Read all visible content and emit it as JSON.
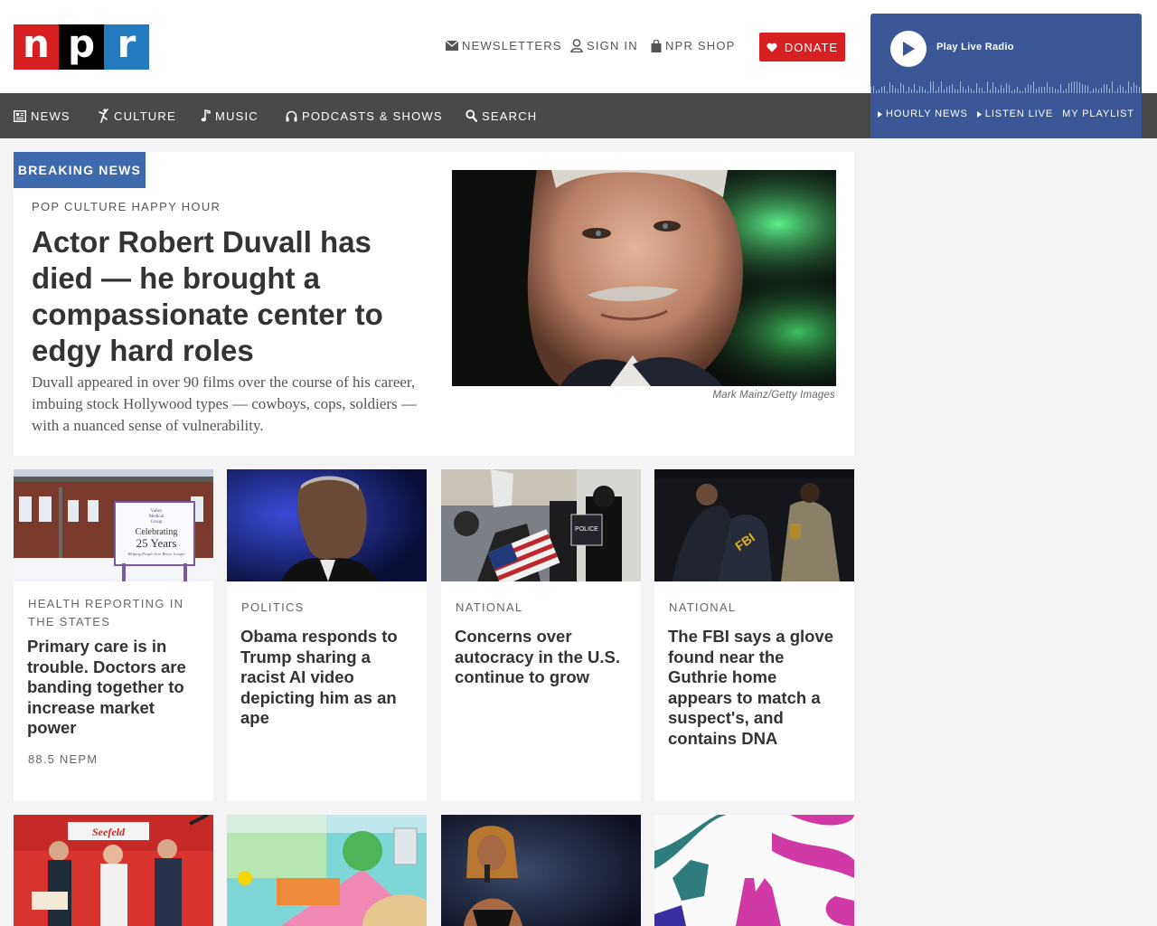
{
  "brand": {
    "logo_letters": [
      "n",
      "p",
      "r"
    ],
    "colors": {
      "red": "#d62021",
      "blue": "#237bbd",
      "black": "#000000",
      "nav_bg": "#494949",
      "player_bg": "#3a5898",
      "breaking_bg": "#3d69ad"
    }
  },
  "utility_nav": {
    "newsletters": {
      "label": "Newsletters",
      "icon": "envelope-icon"
    },
    "sign_in": {
      "label": "Sign In",
      "icon": "user-icon"
    },
    "shop": {
      "label": "NPR Shop",
      "icon": "shopping-bag-icon"
    },
    "donate": {
      "label": "Donate",
      "icon": "heart-icon"
    }
  },
  "main_nav": [
    {
      "label": "News",
      "icon": "newspaper-icon"
    },
    {
      "label": "Culture",
      "icon": "dancer-icon"
    },
    {
      "label": "Music",
      "icon": "music-note-icon"
    },
    {
      "label": "Podcasts & Shows",
      "icon": "headphones-icon"
    },
    {
      "label": "Search",
      "icon": "search-icon"
    }
  ],
  "player": {
    "play_label": "Play Live Radio",
    "links": [
      "Hourly News",
      "Listen Live",
      "My Playlist"
    ]
  },
  "hero": {
    "badge": "BREAKING NEWS",
    "slug": "POP CULTURE HAPPY HOUR",
    "title": "Actor Robert Duvall has died — he brought a compassionate center to edgy hard roles",
    "teaser": "Duvall appeared in over 90 films over the course of his career, imbuing stock Hollywood types — cowboys, cops, soldiers — with a nuanced sense of vulnerability.",
    "image_credit": "Mark Mainz/Getty Images"
  },
  "stories": [
    {
      "slug": "Health Reporting in the States",
      "title": "Primary care is in trouble. Doctors are banding together to increase market power",
      "meta": "88.5 NEPM",
      "sign_lines": [
        "Valley",
        "Medical",
        "Group",
        "Celebrating",
        "25 Years",
        "Helping People Live Better Longer"
      ]
    },
    {
      "slug": "Politics",
      "title": "Obama responds to Trump sharing a racist AI video depicting him as an ape",
      "meta": ""
    },
    {
      "slug": "National",
      "title": "Concerns over autocracy in the U.S. continue to grow",
      "meta": "",
      "shield_text": "POLICE"
    },
    {
      "slug": "National",
      "title": "The FBI says a glove found near the Guthrie home appears to match a suspect's, and contains DNA",
      "meta": "",
      "vest_text": "FBI"
    }
  ],
  "tiles": [
    {
      "banner_text": "Seefeld"
    },
    {},
    {},
    {}
  ]
}
